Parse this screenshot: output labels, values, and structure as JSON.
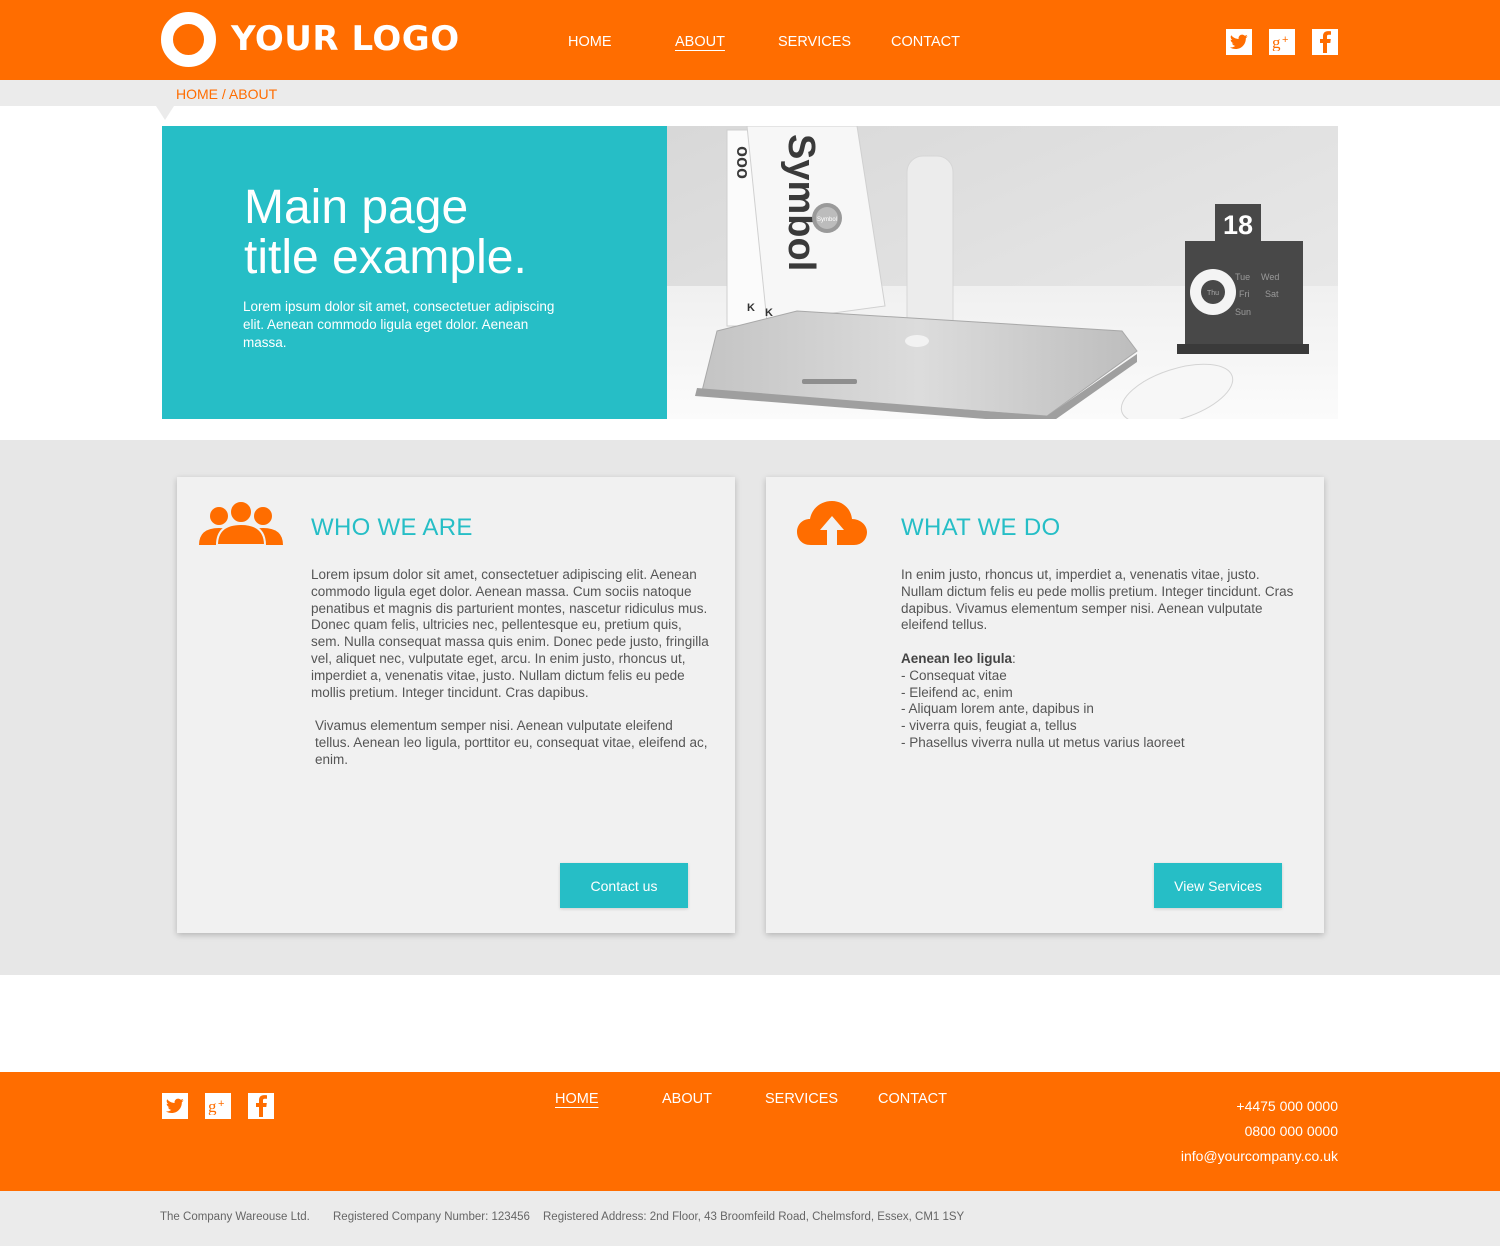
{
  "header": {
    "logo_text": "YOUR LOGO",
    "nav": [
      {
        "label": "HOME",
        "active": false
      },
      {
        "label": "ABOUT",
        "active": true
      },
      {
        "label": "SERVICES",
        "active": false
      },
      {
        "label": "CONTACT",
        "active": false
      }
    ],
    "social_icons": [
      "twitter-icon",
      "google-plus-icon",
      "facebook-icon"
    ]
  },
  "breadcrumb": "HOME / ABOUT",
  "hero": {
    "title_line1": "Main page",
    "title_line2": "title example.",
    "text": "Lorem ipsum dolor sit amet, consectetuer adipiscing elit. Aenean commodo ligula eget dolor. Aenean massa.",
    "image": {
      "book_title": "Symbol",
      "book_sticker": "Symbol",
      "calendar_date": "18",
      "calendar_days": [
        "Tue",
        "Wed",
        "Thu",
        "Fri",
        "Sat",
        "Sun"
      ]
    }
  },
  "cards": [
    {
      "icon": "people-icon",
      "title": "WHO WE ARE",
      "paragraphs": [
        "Lorem ipsum dolor sit amet, consectetuer adipiscing elit. Aenean commodo ligula eget dolor. Aenean massa. Cum sociis natoque penatibus et magnis dis parturient montes, nascetur ridiculus mus.",
        "Donec quam felis, ultricies nec, pellentesque eu, pretium quis, sem. Nulla consequat massa quis enim. Donec pede justo, fringilla vel, aliquet nec, vulputate eget, arcu. In enim justo, rhoncus ut, imperdiet a, venenatis vitae, justo. Nullam dictum felis eu pede mollis pretium. Integer tincidunt. Cras dapibus.",
        "Vivamus elementum semper nisi. Aenean vulputate eleifend tellus. Aenean leo ligula, porttitor eu, consequat vitae, eleifend ac, enim."
      ],
      "button": "Contact us"
    },
    {
      "icon": "cloud-upload-icon",
      "title": "WHAT WE DO",
      "paragraph": "In enim justo, rhoncus ut, imperdiet a, venenatis vitae, justo. Nullam dictum felis eu pede mollis pretium. Integer tincidunt. Cras dapibus. Vivamus elementum semper nisi. Aenean vulputate eleifend tellus.",
      "list_heading": "Aenean leo ligula",
      "list_heading_suffix": ":",
      "list": [
        "- Consequat vitae",
        "- Eleifend ac, enim",
        "- Aliquam lorem ante, dapibus in",
        "- viverra quis, feugiat a, tellus",
        "- Phasellus viverra nulla ut metus varius laoreet"
      ],
      "button": "View Services"
    }
  ],
  "footer": {
    "social_icons": [
      "twitter-icon",
      "google-plus-icon",
      "facebook-icon"
    ],
    "nav": [
      {
        "label": "HOME",
        "active": true
      },
      {
        "label": "ABOUT",
        "active": false
      },
      {
        "label": "SERVICES",
        "active": false
      },
      {
        "label": "CONTACT",
        "active": false
      }
    ],
    "phone1": "+4475 000 0000",
    "phone2": "0800 000 0000",
    "email": "info@yourcompany.co.uk"
  },
  "legal": {
    "company": "The Company Wareouse Ltd.",
    "number": "Registered Company Number: 123456",
    "address": "Registered Address: 2nd Floor, 43 Broomfeild Road, Chelmsford, Essex, CM1 1SY"
  },
  "colors": {
    "accent_orange": "#ff6d00",
    "accent_teal": "#26bec6",
    "band_grey": "#e7e7e7",
    "card_grey": "#f1f1f1"
  }
}
